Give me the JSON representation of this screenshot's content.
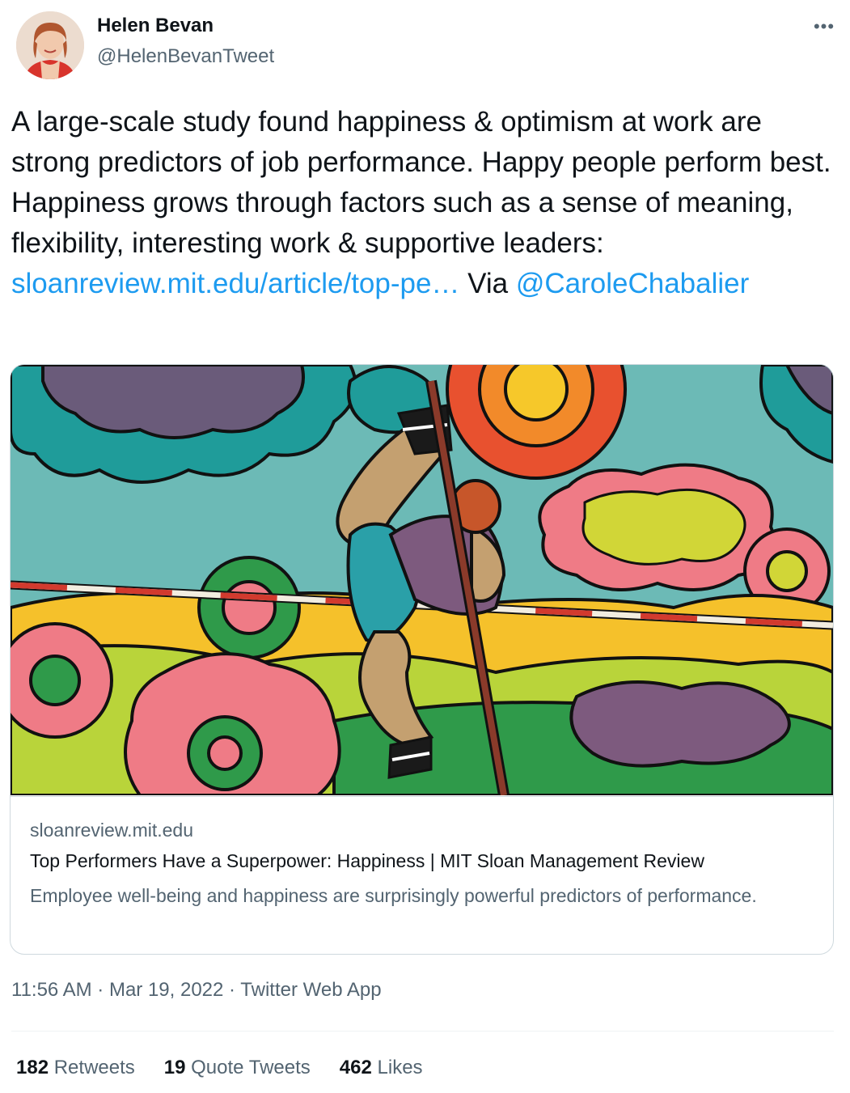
{
  "author": {
    "name": "Helen Bevan",
    "handle": "@HelenBevanTweet",
    "more_icon": "more-horizontal-icon"
  },
  "tweet": {
    "text_before_link": "A large-scale study found happiness & optimism at work are strong predictors of job performance. Happy people perform best. Happiness grows through factors such as a sense of meaning, flexibility, interesting work & supportive leaders: ",
    "link_text": "sloanreview.mit.edu/article/top-pe…",
    "text_middle": " Via ",
    "mention": "@CaroleChabalier"
  },
  "card": {
    "domain": "sloanreview.mit.edu",
    "title": "Top Performers Have a Superpower: Happiness | MIT Sloan Management Review",
    "description": "Employee well-being and happiness are surprisingly powerful predictors of performance."
  },
  "meta": {
    "time": "11:56 AM",
    "separator": " · ",
    "date": "Mar 19, 2022",
    "source": "Twitter Web App"
  },
  "stats": {
    "retweets_count": "182",
    "retweets_label": "Retweets",
    "quotes_count": "19",
    "quotes_label": "Quote Tweets",
    "likes_count": "462",
    "likes_label": "Likes"
  },
  "colors": {
    "link": "#1d9bf0",
    "secondary_text": "#536471",
    "primary_text": "#0f1419",
    "border": "#cfd9de"
  }
}
